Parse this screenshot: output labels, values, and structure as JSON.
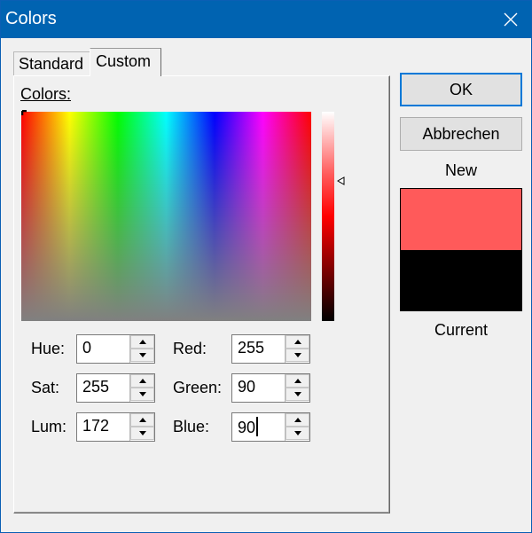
{
  "window": {
    "title": "Colors"
  },
  "tabs": [
    {
      "label": "Standard",
      "active": false
    },
    {
      "label": "Custom",
      "active": true
    }
  ],
  "custom": {
    "colors_label": "Colors:",
    "fields": {
      "hue": {
        "label": "Hue:",
        "value": "0"
      },
      "sat": {
        "label": "Sat:",
        "value": "255"
      },
      "lum": {
        "label": "Lum:",
        "value": "172"
      },
      "red": {
        "label": "Red:",
        "value": "255"
      },
      "green": {
        "label": "Green:",
        "value": "90"
      },
      "blue": {
        "label": "Blue:",
        "value": "90"
      }
    }
  },
  "buttons": {
    "ok": "OK",
    "cancel": "Abbrechen"
  },
  "preview": {
    "new_label": "New",
    "current_label": "Current",
    "new_color": "#ff5a5a",
    "current_color": "#000000"
  },
  "icons": {
    "close": "close-icon",
    "spin_up": "arrow-up-icon",
    "spin_down": "arrow-down-icon",
    "lum_pointer": "triangle-left-icon"
  }
}
